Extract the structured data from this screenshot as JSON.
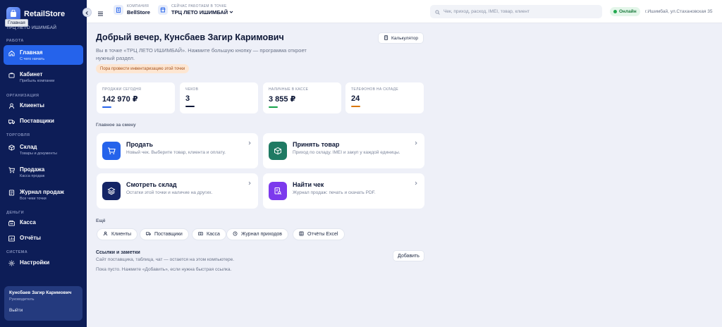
{
  "sidebar": {
    "brand": "RetailStore",
    "tooltip": "Главная",
    "store": "ТРЦ ЛЕТО ИШИМБАЙ",
    "sections": {
      "work": "РАБОТА",
      "org": "ОРГАНИЗАЦИЯ",
      "trade": "ТОРГОВЛЯ",
      "money": "ДЕНЬГИ",
      "system": "СИСТЕМА"
    },
    "items": {
      "home": {
        "label": "Главная",
        "sub": "С чего начать"
      },
      "cabinet": {
        "label": "Кабинет",
        "sub": "Прибыль компании"
      },
      "clients": {
        "label": "Клиенты"
      },
      "suppliers": {
        "label": "Поставщики"
      },
      "warehouse": {
        "label": "Склад",
        "sub": "Товары и документы"
      },
      "sales": {
        "label": "Продажа",
        "sub": "Касса продаж"
      },
      "journal": {
        "label": "Журнал продаж",
        "sub": "Все чеки точки"
      },
      "cash": {
        "label": "Касса"
      },
      "reports": {
        "label": "Отчёты"
      },
      "settings": {
        "label": "Настройки"
      }
    },
    "user": {
      "name": "Кунсбаев Загир Каримович",
      "role": "Руководитель",
      "logout": "Выйти"
    }
  },
  "topbar": {
    "company_label": "КОМПАНИЯ",
    "company": "BellStore",
    "point_label": "СЕЙЧАС РАБОТАЕМ В ТОЧКЕ",
    "point": "ТРЦ ЛЕТО ИШИМБАЙ",
    "search_placeholder": "Чек, приход, расход, IMEI, товар, клиент",
    "status": "Онлайн",
    "address": "г.Ишимбай, ул.Стахановская 35"
  },
  "main": {
    "greeting": "Добрый вечер, Кунсбаев Загир Каримович",
    "calculator": "Калькулятор",
    "intro": "Вы в точке «ТРЦ ЛЕТО ИШИМБАЙ». Нажмите большую кнопку — программа откроет нужный раздел.",
    "warning": "Пора провести инвентаризацию этой точки",
    "stats": [
      {
        "label": "ПРОДАЖИ СЕГОДНЯ",
        "value": "142 970 ₽",
        "color": "#2563eb"
      },
      {
        "label": "ЧЕКОВ",
        "value": "3",
        "color": "#0d1736"
      },
      {
        "label": "НАЛИЧНЫЕ В КАССЕ",
        "value": "3 855 ₽",
        "color": "#16a34a"
      },
      {
        "label": "ТЕЛЕФОНОВ НА СКЛАДЕ",
        "value": "24",
        "color": "#d97706"
      }
    ],
    "shift_label": "Главное за смену",
    "actions": [
      {
        "title": "Продать",
        "sub": "Новый чек. Выберите товар, клиента и оплату.",
        "color": "#2563eb"
      },
      {
        "title": "Принять товар",
        "sub": "Приход по складу. IMEI и закуп у каждой единицы.",
        "color": "#1f7a63"
      },
      {
        "title": "Смотреть склад",
        "sub": "Остатки этой точки и наличие на других.",
        "color": "#142566"
      },
      {
        "title": "Найти чек",
        "sub": "Журнал продаж: печать и скачать PDF.",
        "color": "#7c3aed"
      }
    ],
    "more_label": "Ещё",
    "chips": [
      "Клиенты",
      "Поставщики",
      "Касса",
      "Журнал приходов",
      "Отчёты Excel"
    ],
    "notes": {
      "title": "Ссылки и заметки",
      "sub": "Сайт поставщика, таблица, чат — остается на этом компьютере.",
      "empty": "Пока пусто. Нажмите «Добавить», если нужна быстрая ссылка.",
      "add": "Добавить"
    }
  }
}
